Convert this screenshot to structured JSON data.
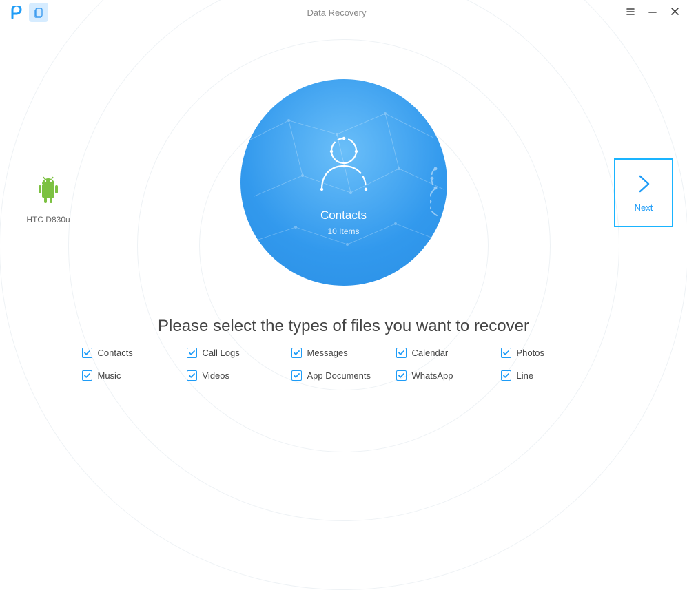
{
  "titlebar": {
    "title": "Data Recovery"
  },
  "device": {
    "name": "HTC D830u"
  },
  "focus": {
    "title": "Contacts",
    "subtitle": "10 Items"
  },
  "next": {
    "label": "Next"
  },
  "instruction": "Please select the types of files you want to recover",
  "types": {
    "items": [
      {
        "label": "Contacts",
        "checked": true
      },
      {
        "label": "Call Logs",
        "checked": true
      },
      {
        "label": "Messages",
        "checked": true
      },
      {
        "label": "Calendar",
        "checked": true
      },
      {
        "label": "Photos",
        "checked": true
      },
      {
        "label": "Music",
        "checked": true
      },
      {
        "label": "Videos",
        "checked": true
      },
      {
        "label": "App Documents",
        "checked": true
      },
      {
        "label": "WhatsApp",
        "checked": true
      },
      {
        "label": "Line",
        "checked": true
      }
    ]
  }
}
